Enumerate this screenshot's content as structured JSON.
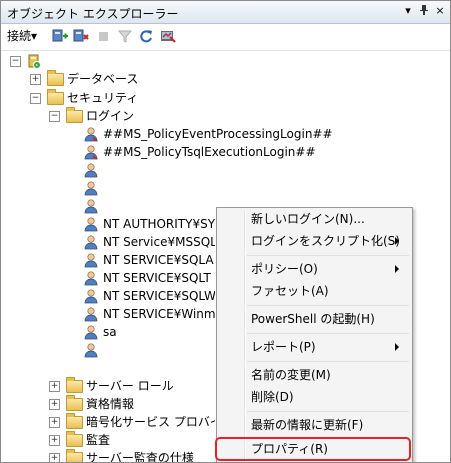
{
  "panel": {
    "title": "オブジェクト エクスプローラー",
    "pin_glyph": "ф",
    "close_glyph": "×",
    "dropdown_glyph": "▾"
  },
  "toolbar": {
    "connect_label": "接続",
    "connect_arrow": "▾"
  },
  "tree": {
    "server_label": "",
    "databases_label": "データベース",
    "security_label": "セキュリティ",
    "logins_label": "ログイン",
    "logins": [
      "##MS_PolicyEventProcessingLogin##",
      "##MS_PolicyTsqlExecutionLogin##",
      "",
      "",
      "",
      "NT AUTHORITY¥SY",
      "NT Service¥MSSQL",
      "NT SERVICE¥SQLA",
      "NT SERVICE¥SQLT",
      "NT SERVICE¥SQLW",
      "NT SERVICE¥Winm",
      "sa",
      ""
    ],
    "server_roles_label": "サーバー ロール",
    "credentials_label": "資格情報",
    "crypto_label": "暗号化サービス プロバイダー",
    "audits_label": "監査",
    "audit_specs_label": "サーバー監査の仕様"
  },
  "context_menu": {
    "new_login": "新しいログイン(N)...",
    "script_login": "ログインをスクリプト化(S)",
    "policies": "ポリシー(O)",
    "facets": "ファセット(A)",
    "powershell": "PowerShell の起動(H)",
    "reports": "レポート(P)",
    "rename": "名前の変更(M)",
    "delete": "削除(D)",
    "refresh": "最新の情報に更新(F)",
    "properties": "プロパティ(R)"
  },
  "colors": {
    "highlight_border": "#e8202a",
    "folder": "#e9bf55"
  },
  "icons": [
    "connect-icon",
    "filter-icon",
    "refresh-icon",
    "stop-icon",
    "folder-icon",
    "login-user-icon",
    "server-icon"
  ]
}
